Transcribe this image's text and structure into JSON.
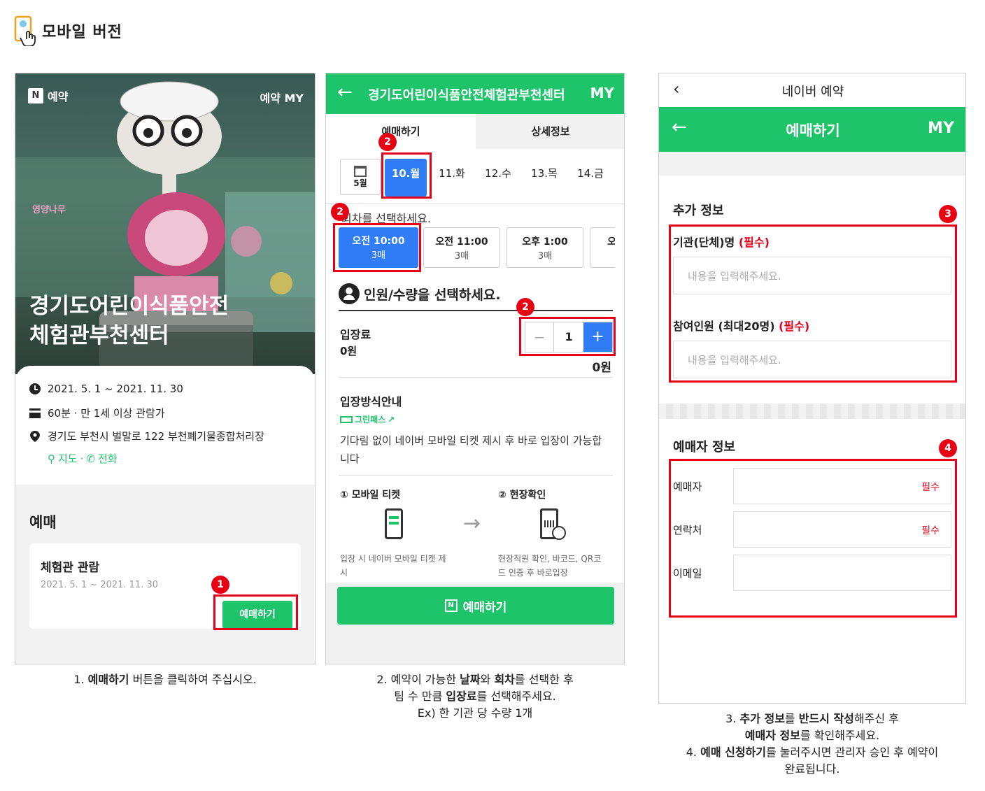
{
  "page_title": "모바일 버전",
  "screen1": {
    "brand": "예약",
    "top_right": "예약 MY",
    "sign": "영양나무",
    "venue_name_line1": "경기도어린이식품안전",
    "venue_name_line2": "체험관부천센터",
    "period": "2021. 5. 1 ~ 2021. 11. 30",
    "duration": "60분 · 만 1세 이상 관람가",
    "address": "경기도 부천시 벌말로 122 부천폐기물종합처리장",
    "map_label": "지도",
    "phone_label": "전화",
    "section": "예매",
    "item_name": "체험관 관람",
    "item_period": "2021. 5. 1 ~ 2021. 11. 30",
    "book_button": "예매하기",
    "badge": "1"
  },
  "screen2": {
    "header_title": "경기도어린이식품안전체험관부천센터",
    "header_my": "MY",
    "tab_booking": "예매하기",
    "tab_detail": "상세정보",
    "month": "5월",
    "dates": [
      "10.월",
      "11.화",
      "12.수",
      "13.목",
      "14.금"
    ],
    "round_prompt": "회차를 선택하세요.",
    "rounds": [
      {
        "time": "오전 10:00",
        "count": "3매"
      },
      {
        "time": "오전 11:00",
        "count": "3매"
      },
      {
        "time": "오후 1:00",
        "count": "3매"
      },
      {
        "time": "오",
        "count": ""
      }
    ],
    "people_prompt": "인원/수량을 선택하세요.",
    "fee_label": "입장료",
    "fee_price": "0원",
    "qty_minus": "−",
    "qty": "1",
    "qty_plus": "+",
    "total": "0원",
    "entry_title": "입장방식안내",
    "greenpass": "그린패스",
    "entry_desc_line1": "기다림 없이 네이버 모바일 티켓 제시 후 바로 입장이 가능합",
    "entry_desc_line2": "니다",
    "step1_title": "① 모바일 티켓",
    "step2_title": "② 현장확인",
    "step1_desc_line1": "입장 시 네이버 모바일 티켓 제",
    "step1_desc_line2": "시",
    "step2_desc_line1": "현장직원 확인, 바코드, QR코",
    "step2_desc_line2": "드 인증 후 바로입장",
    "book_button": "예매하기",
    "badge": "2"
  },
  "screen3": {
    "top_title": "네이버 예약",
    "header_title": "예매하기",
    "header_my": "MY",
    "extra_title": "추가 정보",
    "org_label": "기관(단체)명",
    "required_paren": "(필수)",
    "org_placeholder": "내용을 입력해주세요.",
    "people_label": "참여인원 (최대20명)",
    "people_placeholder": "내용을 입력해주세요.",
    "booker_title": "예매자 정보",
    "booker_label": "예매자",
    "contact_label": "연락처",
    "email_label": "이메일",
    "required": "필수",
    "badge3": "3",
    "badge4": "4"
  },
  "captions": {
    "c1_pre": "1. ",
    "c1_bold": "예매하기",
    "c1_post": " 버튼을 클릭하여 주십시오.",
    "c2_l1_a": "2. 예약이 가능한 ",
    "c2_l1_b": "날짜",
    "c2_l1_c": "와 ",
    "c2_l1_d": "회차",
    "c2_l1_e": "를 선택한 후",
    "c2_l2_a": "팀 수 만큼 ",
    "c2_l2_b": "입장료",
    "c2_l2_c": "를 선택해주세요.",
    "c2_l3": "Ex) 한 기관 당 수량 1개",
    "c3_l1_a": "3. ",
    "c3_l1_b": "추가 정보",
    "c3_l1_c": "를 ",
    "c3_l1_d": "반드시 작성",
    "c3_l1_e": "해주신 후",
    "c3_l2_a": "예매자 정보",
    "c3_l2_b": "를 확인해주세요.",
    "c3_l3_a": "4. ",
    "c3_l3_b": "예매 신청하기",
    "c3_l3_c": "를 눌러주시면 관리자 승인 후 예약이",
    "c3_l4": "완료됩니다."
  },
  "colors": {
    "accent_green": "#1ec46a",
    "accent_blue": "#2f7cf6",
    "highlight_red": "#e6001a"
  }
}
